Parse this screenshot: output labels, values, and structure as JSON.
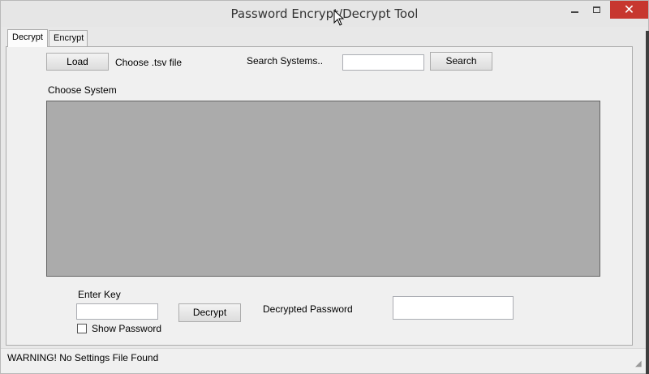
{
  "window": {
    "title": "Password Encrypt/Decrypt Tool",
    "close_glyph": "✕"
  },
  "tabs": [
    {
      "label": "Decrypt",
      "selected": true
    },
    {
      "label": "Encrypt",
      "selected": false
    }
  ],
  "decrypt_tab": {
    "load_button": "Load",
    "choose_file_label": "Choose .tsv file",
    "search_label": "Search Systems..",
    "search_value": "",
    "search_button": "Search",
    "choose_system_label": "Choose System",
    "systems_list": [],
    "enter_key_label": "Enter Key",
    "key_value": "",
    "decrypt_button": "Decrypt",
    "decrypted_password_label": "Decrypted Password",
    "decrypted_password_value": "",
    "show_password_label": "Show Password",
    "show_password_checked": false
  },
  "status": {
    "message": "WARNING! No Settings File Found"
  },
  "colors": {
    "close_button": "#c7372f",
    "list_background": "#ababab"
  }
}
